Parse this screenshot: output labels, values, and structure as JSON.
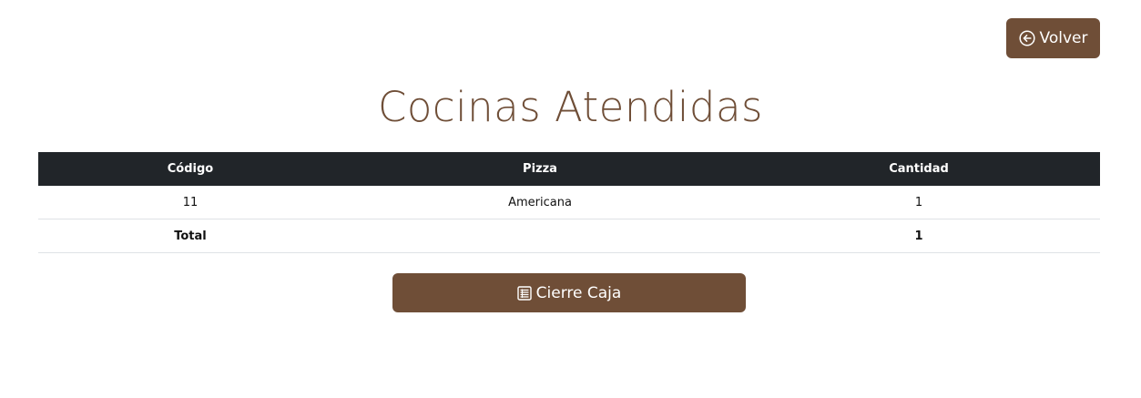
{
  "header": {
    "back_label": "Volver",
    "back_icon": "arrow-left-circle-icon",
    "title": "Cocinas Atendidas"
  },
  "table": {
    "columns": [
      "Código",
      "Pizza",
      "Cantidad"
    ],
    "rows": [
      {
        "codigo": "11",
        "pizza": "Americana",
        "cantidad": "1"
      }
    ],
    "total": {
      "label": "Total",
      "pizza": "",
      "cantidad": "1"
    }
  },
  "actions": {
    "close_label": "Cierre Caja",
    "close_icon": "receipt-icon"
  },
  "colors": {
    "brand": "#6f4e37",
    "table_header": "#212529",
    "border": "#dee2e6"
  }
}
